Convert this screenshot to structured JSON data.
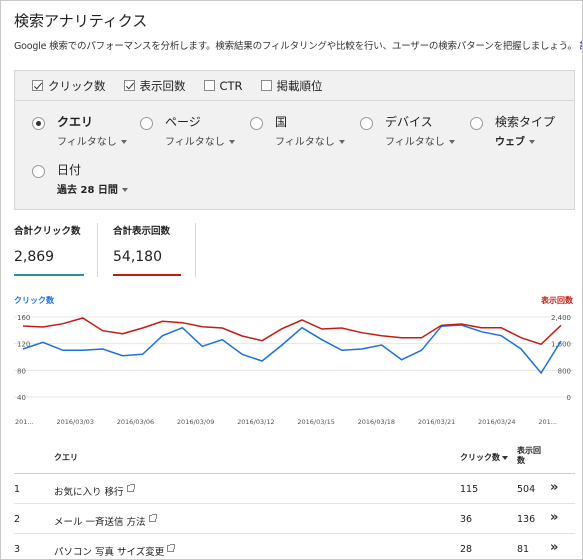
{
  "header": {
    "title": "検索アナリティクス",
    "description": "Google 検索でのパフォーマンスを分析します。検索結果のフィルタリングや比較を行い、ユーザーの検索パターンを把握しましょう。",
    "details_link": "詳細"
  },
  "metrics": [
    {
      "label": "クリック数",
      "checked": true
    },
    {
      "label": "表示回数",
      "checked": true
    },
    {
      "label": "CTR",
      "checked": false
    },
    {
      "label": "掲載順位",
      "checked": false
    }
  ],
  "dimensions": [
    {
      "label": "クエリ",
      "filter": "フィルタなし",
      "selected": true
    },
    {
      "label": "ページ",
      "filter": "フィルタなし",
      "selected": false
    },
    {
      "label": "国",
      "filter": "フィルタなし",
      "selected": false
    },
    {
      "label": "デバイス",
      "filter": "フィルタなし",
      "selected": false
    },
    {
      "label": "検索タイプ",
      "filter": "ウェブ",
      "selected": false
    },
    {
      "label": "日付",
      "filter": "過去 28 日間",
      "selected": false
    }
  ],
  "totals": {
    "clicks_label": "合計クリック数",
    "clicks_value": "2,869",
    "impressions_label": "合計表示回数",
    "impressions_value": "54,180"
  },
  "colors": {
    "clicks": "#1e6fe0",
    "impressions": "#c41c14",
    "clicks_bar": "#2a8fa0"
  },
  "chart_data": {
    "type": "line",
    "left_axis_label": "クリック数",
    "right_axis_label": "表示回数",
    "left_ticks": [
      "160",
      "120",
      "80",
      "40"
    ],
    "right_ticks": [
      "2,400",
      "1,600",
      "800",
      "0"
    ],
    "left_ylim": [
      0,
      160
    ],
    "right_ylim": [
      0,
      2400
    ],
    "x_tick_labels": [
      "201...",
      "2016/03/03",
      "2016/03/06",
      "2016/03/09",
      "2016/03/12",
      "2016/03/15",
      "2016/03/18",
      "2016/03/21",
      "2016/03/24",
      "201..."
    ],
    "x": [
      "2016/02/29",
      "2016/03/01",
      "2016/03/02",
      "2016/03/03",
      "2016/03/04",
      "2016/03/05",
      "2016/03/06",
      "2016/03/07",
      "2016/03/08",
      "2016/03/09",
      "2016/03/10",
      "2016/03/11",
      "2016/03/12",
      "2016/03/13",
      "2016/03/14",
      "2016/03/15",
      "2016/03/16",
      "2016/03/17",
      "2016/03/18",
      "2016/03/19",
      "2016/03/20",
      "2016/03/21",
      "2016/03/22",
      "2016/03/23",
      "2016/03/24",
      "2016/03/25",
      "2016/03/26",
      "2016/03/27"
    ],
    "series": [
      {
        "name": "クリック数",
        "axis": "left",
        "values": [
          112,
          122,
          110,
          110,
          112,
          102,
          104,
          132,
          144,
          116,
          126,
          104,
          94,
          118,
          144,
          126,
          110,
          112,
          118,
          96,
          110,
          146,
          148,
          138,
          132,
          112,
          76,
          124
        ]
      },
      {
        "name": "表示回数",
        "axis": "right",
        "values": [
          2130,
          2100,
          2200,
          2370,
          1990,
          1900,
          2070,
          2270,
          2230,
          2110,
          2070,
          1830,
          1690,
          2050,
          2310,
          2040,
          2070,
          1930,
          1840,
          1780,
          1780,
          2150,
          2190,
          2080,
          2080,
          1780,
          1580,
          2150
        ]
      }
    ]
  },
  "table": {
    "headers": {
      "query": "クエリ",
      "clicks": "クリック数",
      "impressions": "表示回数"
    },
    "rows": [
      {
        "rank": "1",
        "query": "お気に入り 移行",
        "clicks": "115",
        "impressions": "504"
      },
      {
        "rank": "2",
        "query": "メール 一斉送信 方法",
        "clicks": "36",
        "impressions": "136"
      },
      {
        "rank": "3",
        "query": "パソコン 写真 サイズ変更",
        "clicks": "28",
        "impressions": "81"
      }
    ]
  }
}
